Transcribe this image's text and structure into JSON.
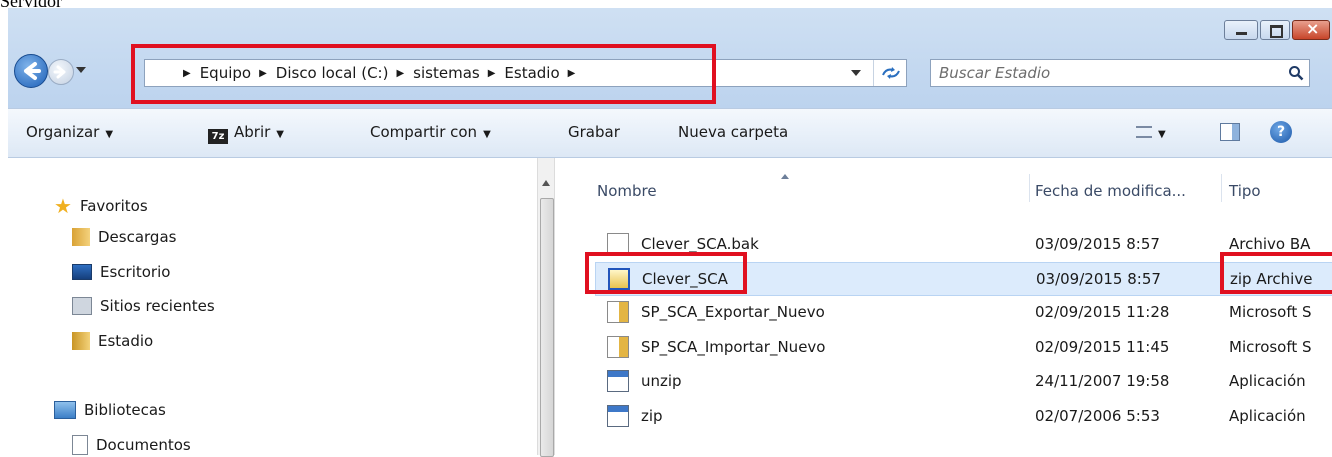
{
  "caption": "Servidor",
  "address": {
    "crumbs": [
      "Equipo",
      "Disco local (C:)",
      "sistemas",
      "Estadio"
    ]
  },
  "search": {
    "placeholder": "Buscar Estadio"
  },
  "toolbar": {
    "organize": "Organizar",
    "open": "Abrir",
    "share": "Compartir con",
    "burn": "Grabar",
    "new_folder": "Nueva carpeta"
  },
  "navigation": {
    "favorites_title": "Favoritos",
    "favorites": [
      "Descargas",
      "Escritorio",
      "Sitios recientes",
      "Estadio"
    ],
    "libraries_title": "Bibliotecas",
    "libraries": [
      "Documentos"
    ]
  },
  "columns": {
    "name": "Nombre",
    "date": "Fecha de modifica...",
    "type": "Tipo"
  },
  "files": [
    {
      "name": "Clever_SCA.bak",
      "date": "03/09/2015 8:57",
      "type": "Archivo BA",
      "icon": "blank-file-icon",
      "selected": false
    },
    {
      "name": "Clever_SCA",
      "date": "03/09/2015 8:57",
      "type": "zip Archive",
      "icon": "zip-archive-icon",
      "selected": true
    },
    {
      "name": "SP_SCA_Exportar_Nuevo",
      "date": "02/09/2015 11:28",
      "type": "Microsoft S",
      "icon": "sql-script-icon",
      "selected": false
    },
    {
      "name": "SP_SCA_Importar_Nuevo",
      "date": "02/09/2015 11:45",
      "type": "Microsoft S",
      "icon": "sql-script-icon",
      "selected": false
    },
    {
      "name": "unzip",
      "date": "24/11/2007 19:58",
      "type": "Aplicación",
      "icon": "application-icon",
      "selected": false
    },
    {
      "name": "zip",
      "date": "02/07/2006 5:53",
      "type": "Aplicación",
      "icon": "application-icon",
      "selected": false
    }
  ],
  "colors": {
    "highlight": "#e01020",
    "selection": "#dcebfc",
    "folder": "#e8b94a"
  }
}
